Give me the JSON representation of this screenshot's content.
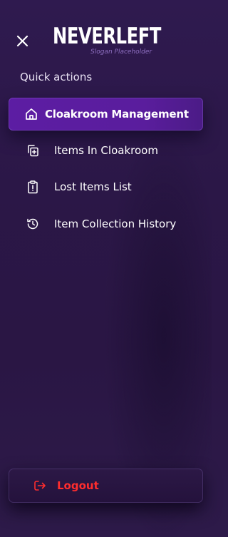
{
  "header": {
    "close_icon": "close-icon",
    "logo_text": "NEVERLEFT",
    "slogan": "Slogan Placeholder"
  },
  "sidebar": {
    "section_title": "Quick actions",
    "items": [
      {
        "label": "Cloakroom Management",
        "icon": "home-icon",
        "active": true
      },
      {
        "label": "Items In Cloakroom",
        "icon": "copy-add-icon",
        "active": false
      },
      {
        "label": "Lost Items List",
        "icon": "clipboard-alert-icon",
        "active": false
      },
      {
        "label": "Item Collection History",
        "icon": "history-icon",
        "active": false
      }
    ],
    "logout_label": "Logout",
    "logout_icon": "logout-icon"
  },
  "colors": {
    "background": "#2b1747",
    "active_item": "#5c1da3",
    "logout_text": "#ff2d2d",
    "slogan": "#8e6fc0"
  }
}
